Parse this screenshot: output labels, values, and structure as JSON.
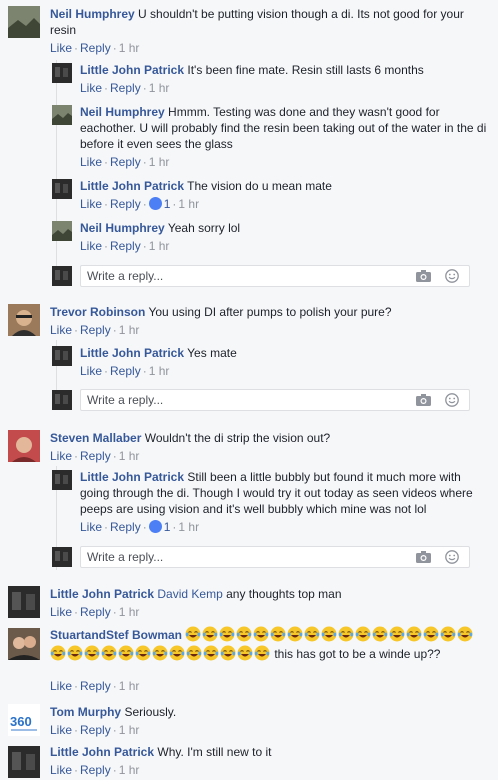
{
  "ui": {
    "like": "Like",
    "reply": "Reply",
    "dot": "·",
    "reply_placeholder": "Write a reply..."
  },
  "threads": [
    {
      "author": "Neil Humphrey",
      "text": "U shouldn't be putting vision though a di. Its not good for your resin",
      "time": "1 hr",
      "replies": [
        {
          "author": "Little John Patrick",
          "text": "It's been fine mate. Resin still lasts 6 months",
          "time": "1 hr"
        },
        {
          "author": "Neil Humphrey",
          "text": "Hmmm. Testing was done and they wasn't good for eachother. U will probably find the resin been taking out of the water in the di before it even sees the glass",
          "time": "1 hr"
        },
        {
          "author": "Little John Patrick",
          "text": "The vision do u mean mate",
          "time": "1 hr",
          "likes": "1"
        },
        {
          "author": "Neil Humphrey",
          "text": "Yeah sorry lol",
          "time": "1 hr"
        }
      ]
    },
    {
      "author": "Trevor Robinson",
      "text": "You using DI after pumps to polish your pure?",
      "time": "1 hr",
      "replies": [
        {
          "author": "Little John Patrick",
          "text": "Yes mate",
          "time": "1 hr"
        }
      ]
    },
    {
      "author": "Steven Mallaber",
      "text": "Wouldn't the di strip the vision out?",
      "time": "1 hr",
      "replies": [
        {
          "author": "Little John Patrick",
          "text": "Still been a little bubbly but found it much more with going through the di. Though I would try it out today as seen videos where peeps are using vision and it's well bubbly which mine was not lol",
          "time": "1 hr",
          "likes": "1"
        }
      ]
    },
    {
      "author": "Little John Patrick",
      "mention": "David Kemp",
      "text": "any thoughts top man",
      "time": "1 hr"
    },
    {
      "author": "StuartandStef Bowman",
      "emoji_count": 30,
      "emoji_name": "tears-of-joy",
      "text": "this has got to be a winde up??",
      "time": "1 hr"
    },
    {
      "author": "Tom Murphy",
      "text": "Seriously.",
      "time": "1 hr"
    },
    {
      "author": "Little John Patrick",
      "text": "Why. I'm still new to it",
      "time": "1 hr"
    }
  ]
}
